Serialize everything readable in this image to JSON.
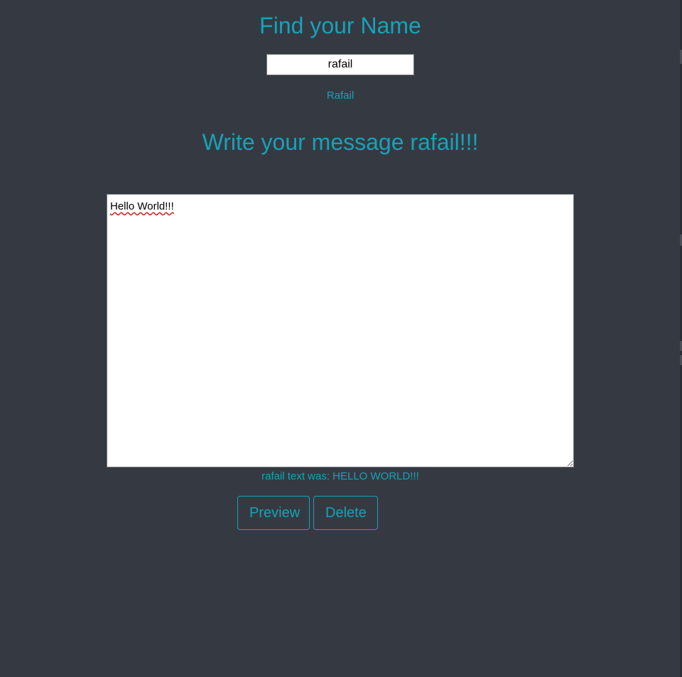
{
  "header": {
    "title": "Find your Name"
  },
  "name_field": {
    "value": "rafail"
  },
  "name_display": "Rafail",
  "message_section": {
    "title": "Write your message rafail!!!",
    "textarea_value": "Hello World!!!",
    "preview_text": "rafail text was: HELLO WORLD!!!"
  },
  "buttons": {
    "preview_label": "Preview",
    "delete_label": "Delete"
  },
  "colors": {
    "background": "#353a42",
    "accent": "#17a2b8",
    "input_bg": "#ffffff"
  }
}
